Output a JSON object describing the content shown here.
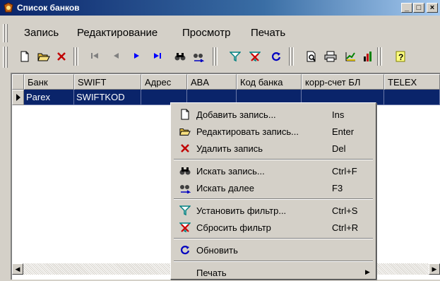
{
  "window": {
    "title": "Список банков"
  },
  "titlebar_buttons": {
    "minimize": "_",
    "maximize": "□",
    "close": "×"
  },
  "menubar": [
    "Запись",
    "Редактирование",
    "Просмотр",
    "Печать"
  ],
  "toolbar": {
    "icons": [
      "new-icon",
      "open-folder-icon",
      "delete-icon",
      "first-record-icon",
      "prev-record-icon",
      "next-record-icon",
      "last-record-icon",
      "find-icon",
      "find-next-icon",
      "filter-icon",
      "clear-filter-icon",
      "refresh-icon",
      "preview-icon",
      "print-icon",
      "chart-icon",
      "bar-chart-icon",
      "help-icon"
    ]
  },
  "grid": {
    "columns": [
      "Банк",
      "SWIFT",
      "Адрес",
      "ABA",
      "Код банка",
      "корр-счет БЛ",
      "TELEX"
    ],
    "rows": [
      [
        "Parex",
        "SWIFTKOD",
        "",
        "",
        "",
        "",
        ""
      ]
    ],
    "selected_row": 0
  },
  "context_menu": {
    "groups": [
      [
        {
          "label": "Добавить запись...",
          "shortcut": "Ins",
          "icon": "new-record-icon"
        },
        {
          "label": "Редактировать запись...",
          "shortcut": "Enter",
          "icon": "edit-record-icon"
        },
        {
          "label": "Удалить запись",
          "shortcut": "Del",
          "icon": "delete-record-icon"
        }
      ],
      [
        {
          "label": "Искать запись...",
          "shortcut": "Ctrl+F",
          "icon": "find-record-icon"
        },
        {
          "label": "Искать далее",
          "shortcut": "F3",
          "icon": "find-next-icon"
        }
      ],
      [
        {
          "label": "Установить фильтр...",
          "shortcut": "Ctrl+S",
          "icon": "set-filter-icon"
        },
        {
          "label": "Сбросить фильтр",
          "shortcut": "Ctrl+R",
          "icon": "clear-filter-icon"
        }
      ],
      [
        {
          "label": "Обновить",
          "shortcut": "",
          "icon": "refresh-icon"
        }
      ],
      [
        {
          "label": "Печать",
          "shortcut": "",
          "icon": "",
          "submenu": true
        }
      ]
    ]
  },
  "colors": {
    "selection": "#0a246a",
    "titlebar_start": "#0a246a",
    "titlebar_end": "#a6caf0",
    "face": "#d4d0c8"
  }
}
